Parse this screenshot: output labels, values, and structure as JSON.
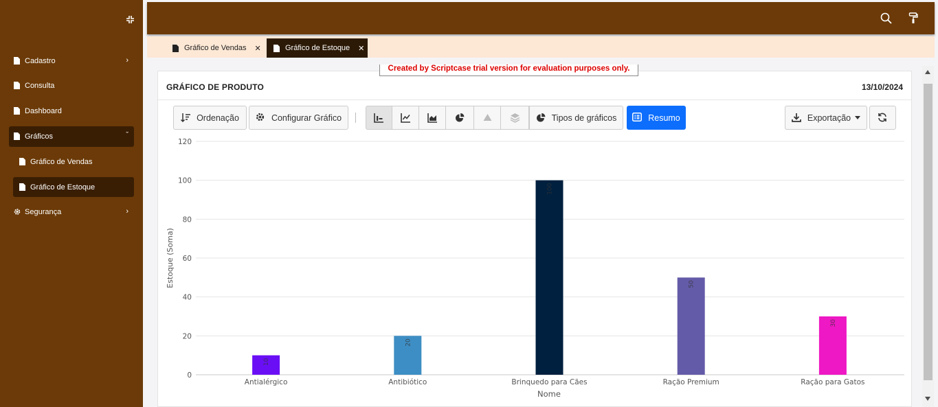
{
  "sidebar": {
    "items": [
      {
        "label": "Cadastro"
      },
      {
        "label": "Consulta"
      },
      {
        "label": "Dashboard"
      },
      {
        "label": "Gráficos"
      },
      {
        "label": "Segurança"
      }
    ],
    "sub_items": [
      {
        "label": "Gráfico de Vendas"
      },
      {
        "label": "Gráfico de Estoque"
      }
    ]
  },
  "tabs": [
    {
      "label": "Gráfico de Vendas"
    },
    {
      "label": "Gráfico de Estoque"
    }
  ],
  "trial_notice": "Created by Scriptcase trial version for evaluation purposes only.",
  "card": {
    "title": "GRÁFICO DE PRODUTO",
    "date": "13/10/2024"
  },
  "toolbar": {
    "sort_label": "Ordenação",
    "config_label": "Configurar Gráfico",
    "chart_types_label": "Tipos de gráficos",
    "summary_label": "Resumo",
    "export_label": "Exportação"
  },
  "icons": {
    "collapse": "compress-icon",
    "search": "search-icon",
    "paint": "paint-roller-icon",
    "doc": "file-icon",
    "gear": "gear-icon",
    "refresh": "refresh-icon",
    "download": "download-icon"
  },
  "colors": {
    "sidebar": "#6b3a08",
    "sidebar_active": "#3a1e04",
    "tabbar": "#fde8d5",
    "primary": "#0d6efd"
  },
  "chart_data": {
    "type": "bar",
    "categories": [
      "Antialérgico",
      "Antibiótico",
      "Brinquedo para Cães",
      "Ração Premium",
      "Ração para Gatos"
    ],
    "values": [
      10,
      20,
      100,
      50,
      30
    ],
    "data_labels": [
      "10",
      "20",
      "100",
      "50",
      "30"
    ],
    "colors": [
      "#6a0ff5",
      "#3d8ec4",
      "#00203f",
      "#645ba8",
      "#ee18c4"
    ],
    "xlabel": "Nome",
    "ylabel": "Estoque (Soma)",
    "ylim": [
      0,
      120
    ],
    "yticks": [
      "0",
      "20",
      "40",
      "60",
      "80",
      "100",
      "120"
    ],
    "grid": true
  }
}
